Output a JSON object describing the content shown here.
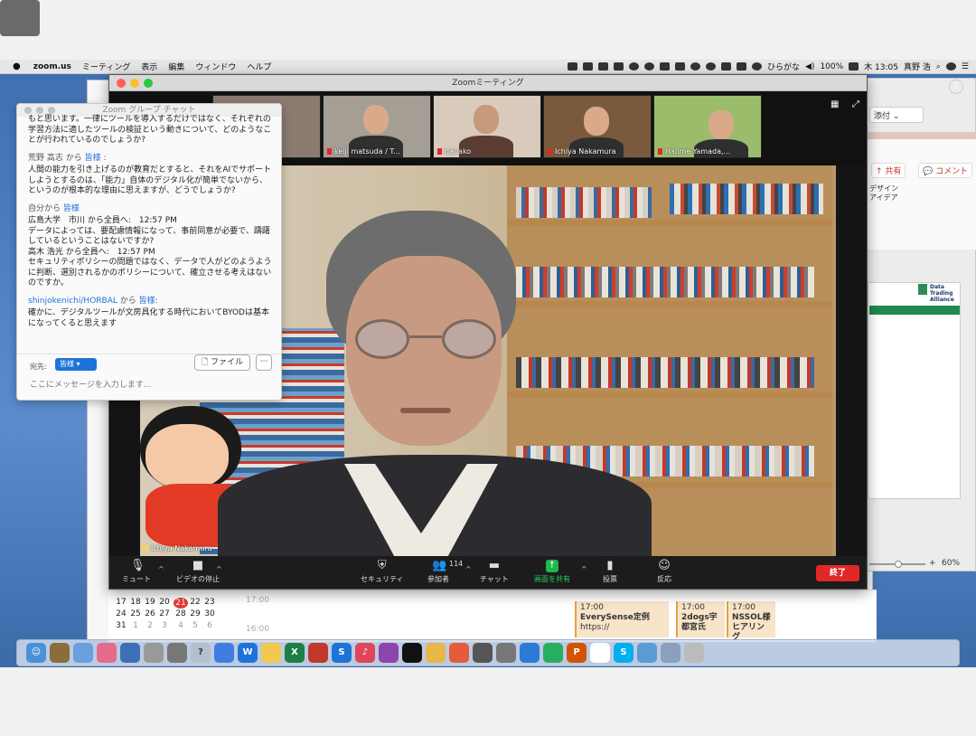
{
  "menubar": {
    "apple": "",
    "items": [
      "zoom.us",
      "ミーティング",
      "表示",
      "編集",
      "ウィンドウ",
      "ヘルプ"
    ],
    "input_method": "ひらがな",
    "battery": "100%",
    "clock": "木 13:05",
    "user": "真野 浩"
  },
  "zoom": {
    "window_title": "Zoomミーティング",
    "participants": [
      {
        "name": "keiji matsuda / T..."
      },
      {
        "name": "nanako"
      },
      {
        "name": "Ichiya Nakamura"
      },
      {
        "name": "Hajime Yamada,..."
      }
    ],
    "active_speaker": "Ichiya Nakamura",
    "controls": {
      "mute": "ミュート",
      "stop_video": "ビデオの停止",
      "security": "セキュリティ",
      "participants": "参加者",
      "participant_count": "114",
      "chat": "チャット",
      "share_screen": "画面を共有",
      "poll": "投票",
      "reactions": "反応",
      "end": "終了"
    }
  },
  "chat": {
    "title": "Zoom グループ チャット",
    "messages": [
      {
        "text": "もと思います。一律にツールを導入するだけではなく、それぞれの学習方法に適したツールの検証という動きについて、どのようなことが行われているのでしょうか?"
      },
      {
        "from": "荒野 高志 から",
        "to": "皆様",
        "suffix": ":",
        "text": "人間の能力を引き上げるのが教育だとすると、それをAIでサポートしようとするのは、「能力」自体のデジタル化が簡単でないから、というのが根本的な理由に思えますが、どうでしょうか?"
      },
      {
        "from": "自分から",
        "to": "皆様",
        "suffix": ":",
        "text": "広島大学　市川 から全員へ:　12:57 PM\nデータによっては、要配慮情報になって、事前同意が必要で、躊躇しているということはないですか?\n高木 浩光 から全員へ:　12:57 PM\nセキュリティポリシーの問題ではなく、データで人がどのようように判断、選別されるかのポリシーについて、確立させる考えはないのですか。"
      },
      {
        "from": "shinjokenichi/HORBAL",
        "from_suffix": " から ",
        "to": "皆様",
        "suffix": ":",
        "text": "確かに、デジタルツールが文房具化する時代においてBYODは基本になってくると思えます"
      }
    ],
    "to_label": "宛先:",
    "to_value": "皆様",
    "file_button": "ファイル",
    "more_button": "···",
    "input_placeholder": "ここにメッセージを入力します..."
  },
  "side": {
    "attach": "添付",
    "share": "共有",
    "comment": "コメント",
    "design_idea": "デザイン\nアイデア",
    "dta_logo": "Data\nTrading\nAlliance",
    "zoom_level": "60%"
  },
  "calendar": {
    "rows": [
      [
        "17",
        "18",
        "19",
        "20",
        "21",
        "22",
        "23"
      ],
      [
        "24",
        "25",
        "26",
        "27",
        "28",
        "29",
        "30"
      ],
      [
        "31",
        "1",
        "2",
        "3",
        "4",
        "5",
        "6"
      ]
    ],
    "today": "21",
    "time1": "17:00",
    "time2": "16:00",
    "events": [
      {
        "time": "17:00",
        "title": "EverySense定例",
        "sub": "https://"
      },
      {
        "time": "17:00",
        "title": "2dogs宇",
        "sub": "都宮氏"
      },
      {
        "time": "17:00",
        "title": "NSSOL様",
        "sub": "ヒアリング"
      }
    ]
  },
  "colors": {
    "zoom_red": "#e02828",
    "zoom_green": "#2ec95a",
    "chat_blue": "#1e73d9"
  }
}
